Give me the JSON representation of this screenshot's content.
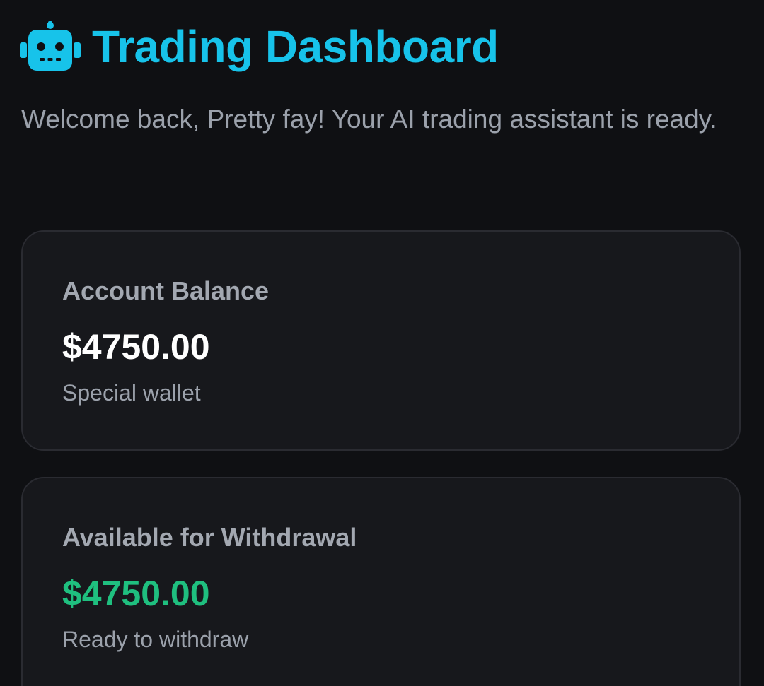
{
  "header": {
    "icon": "robot-icon",
    "title": "Trading Dashboard"
  },
  "welcome": {
    "text": "Welcome back, Pretty fay! Your AI trading assistant is ready."
  },
  "cards": [
    {
      "label": "Account Balance",
      "amount": "$4750.00",
      "subtext": "Special wallet"
    },
    {
      "label": "Available for Withdrawal",
      "amount": "$4750.00",
      "subtext": "Ready to withdraw"
    }
  ],
  "colors": {
    "background": "#0f1013",
    "accent": "#17c3ea",
    "card_bg": "#17181c",
    "positive": "#1fbf7f",
    "muted_text": "#9ba1ab"
  }
}
